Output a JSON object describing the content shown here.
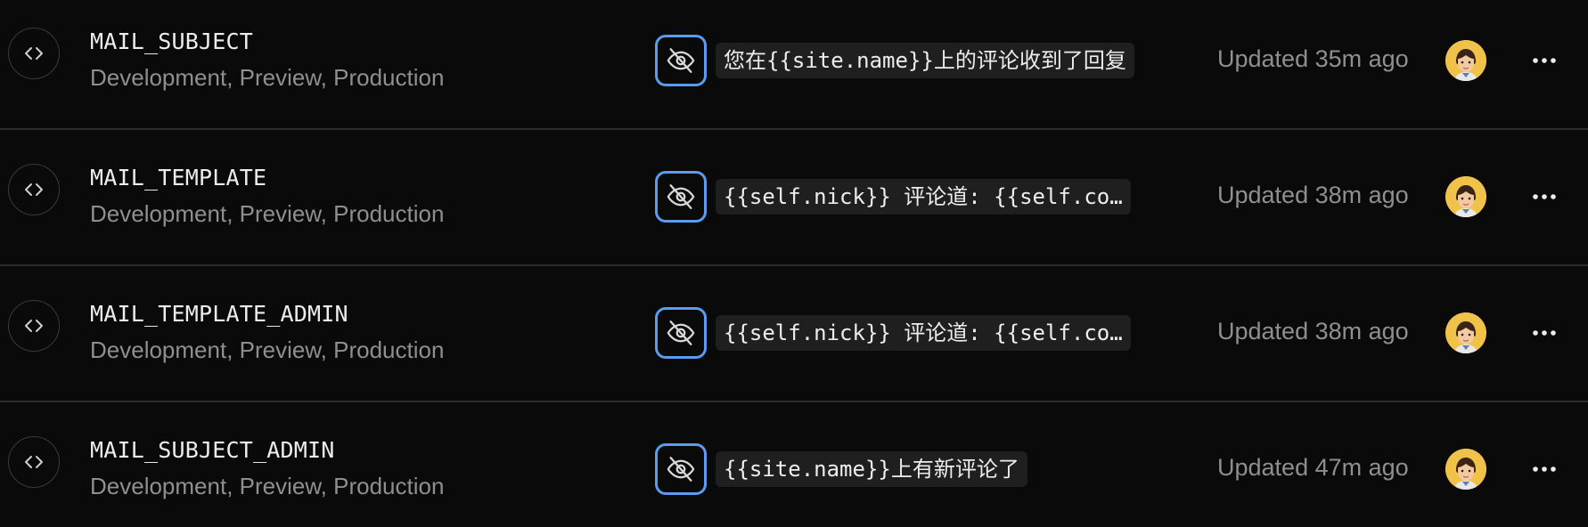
{
  "variables": [
    {
      "name": "MAIL_SUBJECT",
      "environments": "Development, Preview, Production",
      "value": "您在{{site.name}}上的评论收到了回复",
      "updated": "Updated 35m ago"
    },
    {
      "name": "MAIL_TEMPLATE",
      "environments": "Development, Preview, Production",
      "value": "{{self.nick}} 评论道: {{self.co…",
      "updated": "Updated 38m ago"
    },
    {
      "name": "MAIL_TEMPLATE_ADMIN",
      "environments": "Development, Preview, Production",
      "value": "{{self.nick}} 评论道: {{self.co…",
      "updated": "Updated 38m ago"
    },
    {
      "name": "MAIL_SUBJECT_ADMIN",
      "environments": "Development, Preview, Production",
      "value": "{{site.name}}上有新评论了",
      "updated": "Updated 47m ago"
    }
  ],
  "icons": {
    "type": "code-brackets-icon",
    "toggle": "eye-off-icon",
    "menu": "more-horizontal-icon"
  },
  "colors": {
    "background": "#0a0a0a",
    "focus_ring": "#5b9cf0",
    "avatar_bg": "#f1c24a"
  }
}
